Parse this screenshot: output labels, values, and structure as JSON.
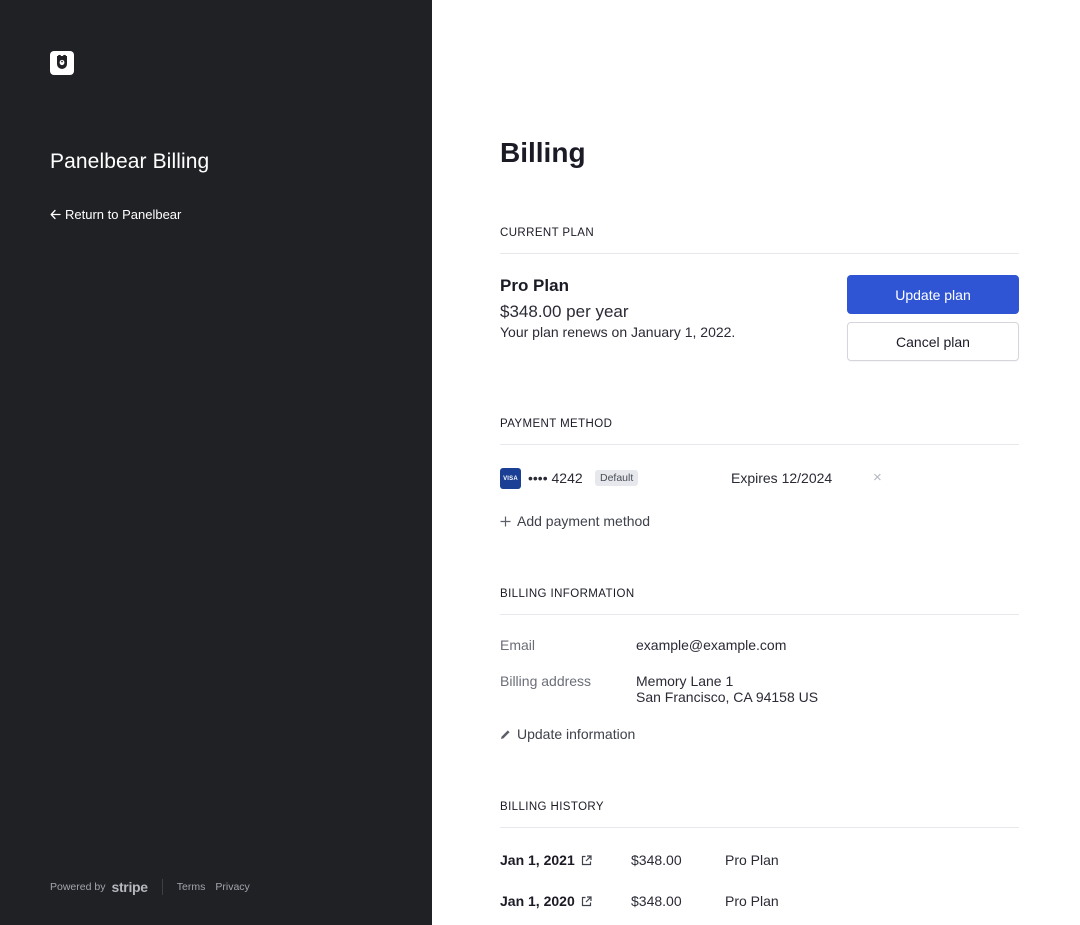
{
  "sidebar": {
    "logo_icon": "bear-shield-icon",
    "title": "Panelbear Billing",
    "return_link": "Return to Panelbear",
    "footer": {
      "powered_by": "Powered by",
      "stripe": "stripe",
      "terms": "Terms",
      "privacy": "Privacy"
    }
  },
  "page": {
    "title": "Billing"
  },
  "current_plan": {
    "heading": "CURRENT PLAN",
    "name": "Pro Plan",
    "price": "$348.00 per year",
    "renewal": "Your plan renews on January 1, 2022.",
    "update_button": "Update plan",
    "cancel_button": "Cancel plan"
  },
  "payment_method": {
    "heading": "PAYMENT METHOD",
    "card": {
      "brand": "VISA",
      "digits": "•••• 4242",
      "badge": "Default",
      "expires": "Expires 12/2024",
      "remove": "×"
    },
    "add_link": "Add payment method"
  },
  "billing_information": {
    "heading": "BILLING INFORMATION",
    "email_label": "Email",
    "email_value": "example@example.com",
    "address_label": "Billing address",
    "address_line1": "Memory Lane 1",
    "address_line2": "San Francisco, CA 94158 US",
    "update_link": "Update information"
  },
  "billing_history": {
    "heading": "BILLING HISTORY",
    "rows": [
      {
        "date": "Jan 1, 2021",
        "amount": "$348.00",
        "plan": "Pro Plan"
      },
      {
        "date": "Jan 1, 2020",
        "amount": "$348.00",
        "plan": "Pro Plan"
      }
    ]
  },
  "colors": {
    "sidebar_bg": "#202125",
    "primary": "#2f55d4",
    "visa_blue": "#1a3f94"
  }
}
